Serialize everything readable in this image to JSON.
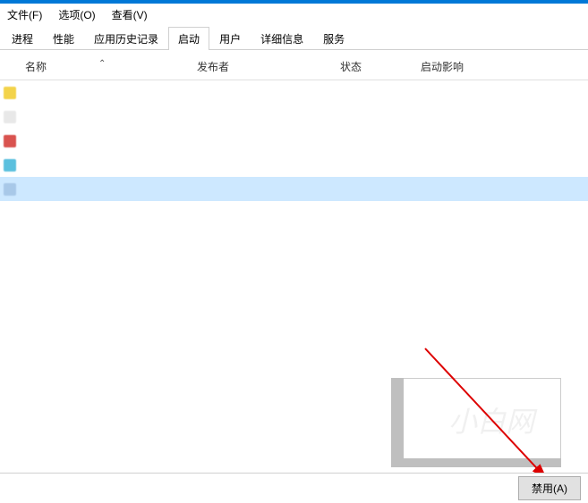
{
  "menu": {
    "file": "文件(F)",
    "options": "选项(O)",
    "view": "查看(V)"
  },
  "tabs": {
    "processes": "进程",
    "performance": "性能",
    "app_history": "应用历史记录",
    "startup": "启动",
    "users": "用户",
    "details": "详细信息",
    "services": "服务"
  },
  "columns": {
    "name": "名称",
    "publisher": "发布者",
    "status": "状态",
    "impact": "启动影响"
  },
  "footer": {
    "disable_button": "禁用(A)"
  },
  "rows": [
    {
      "icon_color": "#f3d34a",
      "name_w": 120,
      "pub_w": 60,
      "status_w": 40,
      "impact_w": 50,
      "selected": false
    },
    {
      "icon_color": "#e8e8e8",
      "name_w": 80,
      "pub_w": 0,
      "status_w": 40,
      "impact_w": 40,
      "selected": false
    },
    {
      "icon_color": "#d9534f",
      "name_w": 110,
      "pub_w": 110,
      "status_w": 40,
      "impact_w": 50,
      "selected": false
    },
    {
      "icon_color": "#5bc0de",
      "name_w": 160,
      "pub_w": 90,
      "status_w": 40,
      "impact_w": 50,
      "selected": false
    },
    {
      "icon_color": "#a8c8e8",
      "name_w": 140,
      "pub_w": 0,
      "status_w": 40,
      "impact_w": 50,
      "selected": true
    }
  ]
}
